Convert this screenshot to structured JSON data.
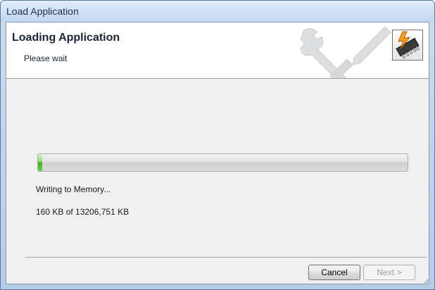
{
  "window": {
    "title": "Load Application"
  },
  "header": {
    "title": "Loading Application",
    "subtitle": "Please wait",
    "decor_icon": "wrench-screwdriver-icon",
    "app_icon": "memory-chip-lightning-icon"
  },
  "progress": {
    "fraction": 0.012
  },
  "status": {
    "message": "Writing to Memory...",
    "size_text": "160 KB of 13206,751 KB"
  },
  "buttons": {
    "cancel_label": "Cancel",
    "next_label": "Next >"
  },
  "colors": {
    "progress_fill": "#3cb11c",
    "header_bg": "#ffffff",
    "titlebar": "#cfe0f5"
  }
}
